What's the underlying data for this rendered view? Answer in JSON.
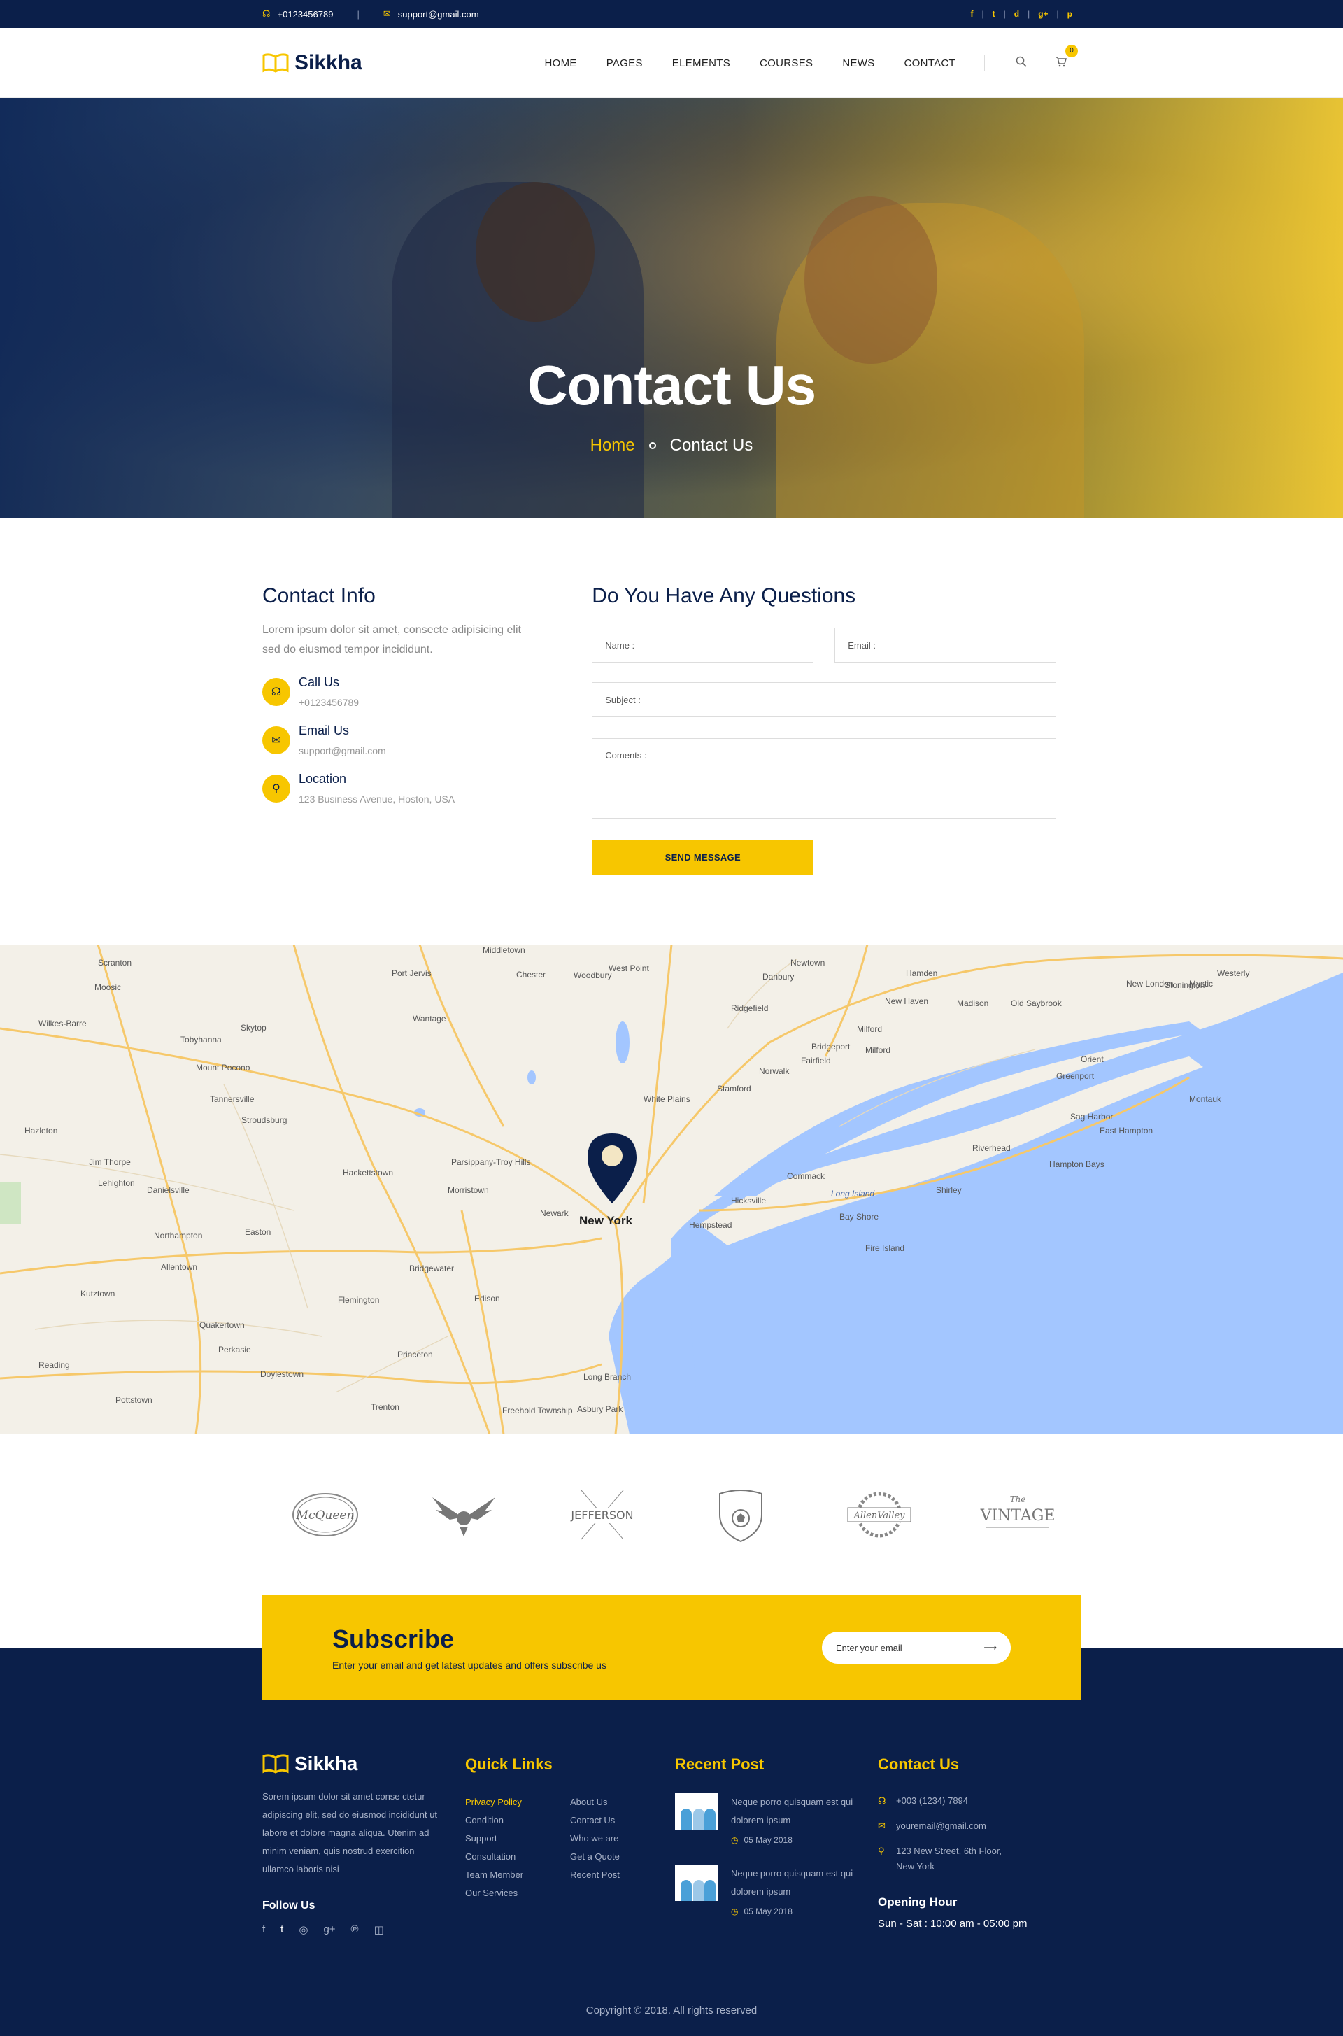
{
  "topbar": {
    "phone": "+0123456789",
    "email": "support@gmail.com",
    "socials": [
      "f",
      "t",
      "d",
      "g+",
      "p"
    ]
  },
  "header": {
    "logo": "Sikkha",
    "nav": [
      "HOME",
      "PAGES",
      "ELEMENTS",
      "COURSES",
      "NEWS",
      "CONTACT"
    ],
    "cart_count": "0"
  },
  "hero": {
    "title": "Contact Us",
    "crumb_home": "Home",
    "crumb_current": "Contact Us"
  },
  "contact_info": {
    "title": "Contact Info",
    "lead": "Lorem ipsum dolor sit amet, consecte adipisicing elit sed do eiusmod tempor incididunt.",
    "items": [
      {
        "label": "Call Us",
        "value": "+0123456789"
      },
      {
        "label": "Email Us",
        "value": "support@gmail.com"
      },
      {
        "label": "Location",
        "value": "123 Business Avenue, Hoston, USA"
      }
    ]
  },
  "form": {
    "title": "Do You Have Any Questions",
    "name": "Name :",
    "email": "Email :",
    "subject": "Subject :",
    "comments": "Coments :",
    "send": "SEND MESSAGE"
  },
  "map": {
    "labels": [
      "Scranton",
      "Port Jervis",
      "Middletown",
      "West Point",
      "Danbury",
      "Newtown",
      "Hamden",
      "New Haven",
      "New London",
      "Westerly",
      "Stamford",
      "Bridgeport",
      "Milford",
      "Norwalk",
      "Fairfield",
      "White Plains",
      "New York",
      "Newark",
      "Hempstead",
      "Long Island",
      "Hicksville",
      "Commack",
      "Riverhead",
      "Montauk",
      "Allentown",
      "Easton",
      "Stroudsburg",
      "Morristown",
      "Edison",
      "Princeton",
      "Trenton",
      "Freehold Township",
      "Asbury Park",
      "Long Branch",
      "Reading",
      "Pottstown",
      "Doylestown",
      "Flemington",
      "Bridgewater",
      "Hackettstown",
      "Wilkes-Barre",
      "Hazleton",
      "Greenport",
      "Sag Harbor",
      "East Hampton",
      "Shirley",
      "Bay Shore",
      "Fire Island",
      "Orient",
      "Mount Pocono",
      "Tannersville",
      "Danielsville",
      "Lehighton",
      "Kutztown",
      "Quakertown",
      "Perkasie",
      "Mystic",
      "Old Saybrook",
      "Madison",
      "Stonington",
      "Ridgefield",
      "Woodbury",
      "Chester",
      "Milford",
      "Skytop",
      "Parsippany-Troy Hills",
      "Tobyhanna",
      "Moosic",
      "Northampton",
      "Jim Thorpe",
      "Wantage",
      "Hampton Bays"
    ]
  },
  "subscribe": {
    "title": "Subscribe",
    "text": "Enter  your email and get latest updates and offers subscribe us",
    "placeholder": "Enter your email"
  },
  "footer": {
    "logo": "Sikkha",
    "desc": "Sorem ipsum dolor sit amet conse ctetur adipiscing elit, sed do eiusmod incididunt ut labore et dolore magna aliqua. Utenim ad minim veniam, quis nostrud exercition ullamco laboris nisi",
    "follow": "Follow Us",
    "quick_title": "Quick Links",
    "links_a": [
      "Privacy Policy",
      "Condition",
      "Support",
      "Consultation",
      "Team Member",
      "Our Services"
    ],
    "links_b": [
      "About Us",
      "Contact Us",
      "Who we are",
      "Get a Quote",
      "Recent Post"
    ],
    "recent_title": "Recent Post",
    "posts": [
      {
        "text": "Neque porro quisquam est qui dolorem ipsum",
        "date": "05 May 2018"
      },
      {
        "text": "Neque porro quisquam est qui dolorem ipsum",
        "date": "05 May 2018"
      }
    ],
    "contact_title": "Contact Us",
    "phone": "+003 (1234) 7894",
    "email": "youremail@gmail.com",
    "address": "123 New Street, 6th Floor, New York",
    "hours_title": "Opening Hour",
    "hours": "Sun - Sat : 10:00 am - 05:00 pm",
    "copyright": "Copyright © 2018. All rights reserved"
  }
}
